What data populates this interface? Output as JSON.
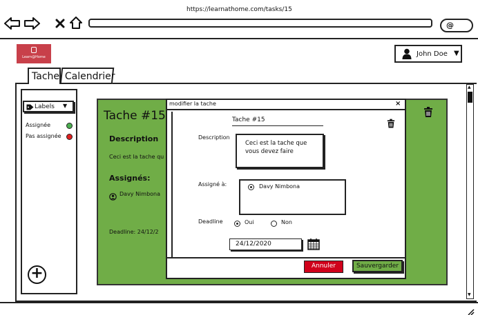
{
  "browser": {
    "url": "https://learnathome.com/tasks/15",
    "icons": [
      "back-arrow-icon",
      "forward-arrow-icon",
      "close-x-icon",
      "home-icon",
      "search-icon"
    ]
  },
  "header": {
    "logo_text": "Learn@Home",
    "user_name": "John Doe"
  },
  "tabs": [
    {
      "label": "Tache"
    },
    {
      "label": "Calendrier"
    }
  ],
  "sidebar": {
    "labels_button": "Labels",
    "items": [
      {
        "label": "Assignée",
        "color": "#4caf50"
      },
      {
        "label": "Pas assignée",
        "color": "#e02020"
      }
    ]
  },
  "card": {
    "title": "Tache #15",
    "description_heading": "Description",
    "description_text": "Ceci est la tache qu",
    "assignees_heading": "Assignés:",
    "assignee": "Davy Nimbona",
    "deadline_text": "Deadline:  24/12/2",
    "background": "#70ad47"
  },
  "modal": {
    "title": "modifier la tache",
    "close": "×",
    "task_name": "Tache #15",
    "description_label": "Description",
    "description_value": "Ceci est la tache que vous devez faire",
    "assigned_label": "Assigné à:",
    "assigned_value": "Davy Nimbona",
    "deadline_label": "Deadline",
    "deadline_yes": "Oui",
    "deadline_no": "Non",
    "deadline_selected": "Oui",
    "date_value": "24/12/2020",
    "cancel_label": "Annuler",
    "save_label": "Sauvergarder",
    "cancel_color": "#d0021b",
    "save_color": "#70ad47"
  }
}
